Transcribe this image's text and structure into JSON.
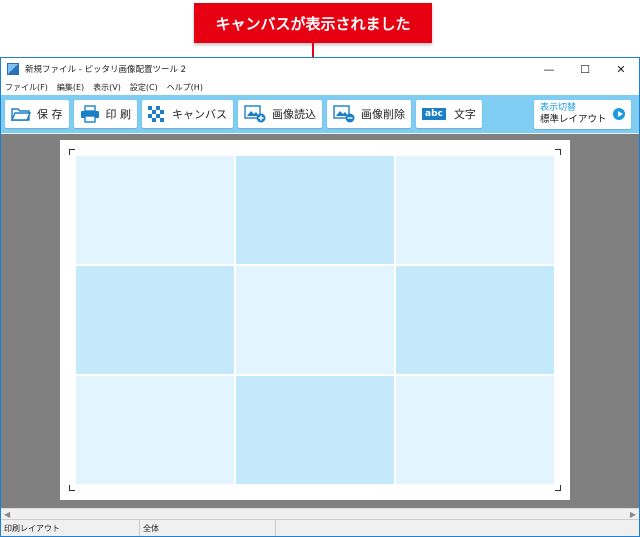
{
  "callout": {
    "text": "キャンバスが表示されました",
    "color": "#e60012"
  },
  "window": {
    "title": "新規ファイル - ピッタリ画像配置ツール 2",
    "controls": {
      "minimize": "—",
      "maximize": "☐",
      "close": "✕"
    }
  },
  "menu": [
    "ファイル(F)",
    "編集(E)",
    "表示(V)",
    "設定(C)",
    "ヘルプ(H)"
  ],
  "toolbar": {
    "background": "#7fcdf3",
    "buttons": [
      {
        "label": "保 存",
        "icon": "folder-icon"
      },
      {
        "label": "印 刷",
        "icon": "printer-icon"
      },
      {
        "label": "キャンバス",
        "icon": "checkerboard-icon"
      },
      {
        "label": "画像読込",
        "icon": "image-add-icon"
      },
      {
        "label": "画像削除",
        "icon": "image-remove-icon"
      },
      {
        "label": "文字",
        "icon": "text-abc-icon",
        "icon_text": "abc"
      }
    ],
    "switch": {
      "line1": "表示切替",
      "line2": "標準レイアウト"
    }
  },
  "canvas": {
    "cell_colors": [
      "#e2f4fd",
      "#c4e9fb",
      "#e2f4fd",
      "#c4e9fb",
      "#e2f4fd",
      "#c4e9fb",
      "#e2f4fd",
      "#c4e9fb",
      "#e2f4fd"
    ]
  },
  "statusbar": {
    "layout": "印刷レイアウト",
    "view": "全体"
  }
}
